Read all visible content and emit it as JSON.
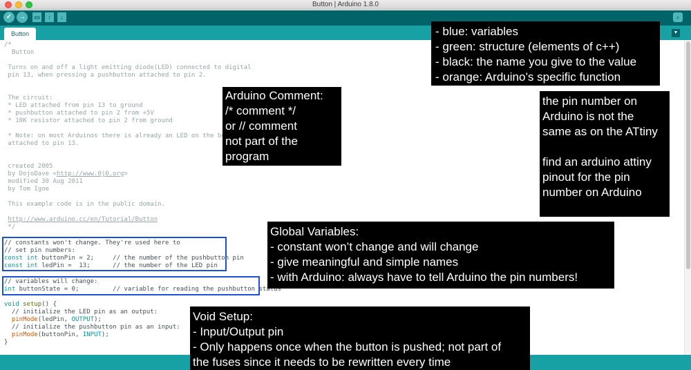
{
  "window": {
    "title": "Button | Arduino 1.8.0"
  },
  "toolbar": {
    "verify_icon": "checkmark-icon",
    "upload_icon": "arrow-right-icon",
    "new_icon": "new-file-icon",
    "open_icon": "arrow-up-icon",
    "save_icon": "arrow-down-icon",
    "serial_icon": "magnifier-icon"
  },
  "tabs": [
    {
      "label": "Button"
    }
  ],
  "code": [
    "/*",
    "  Button",
    "",
    " Turns on and off a light emitting diode(LED) connected to digital",
    " pin 13, when pressing a pushbutton attached to pin 2.",
    "",
    "",
    " The circuit:",
    " * LED attached from pin 13 to ground",
    " * pushbutton attached to pin 2 from +5V",
    " * 10K resistor attached to pin 2 from ground",
    "",
    " * Note: on most Arduinos there is already an LED on the board",
    " attached to pin 13.",
    "",
    "",
    " created 2005",
    " by DojoDave <",
    " modified 30 Aug 2011",
    " by Tom Igoe",
    "",
    " This example code is in the public domain.",
    "",
    " ",
    " */"
  ],
  "code_link_1": "http://www.0j0.org",
  "code_link_1_after": ">",
  "code_link_2": "http://www.arduino.cc/en/Tutorial/Button",
  "globals": {
    "comment1": "// constants won't change. They're used here to",
    "comment2": "// set pin numbers:",
    "kw_const": "const",
    "kw_int": "int",
    "line3_rest": " buttonPin = 2;     // the number of the pushbutton pin",
    "line4_rest": " ledPin =  13;      // the number of the LED pin",
    "comment5": "// variables will change:",
    "line6_rest": " buttonState = 0;         // variable for reading the pushbutton status"
  },
  "setup": {
    "kw_void": "void",
    "fn_setup": "setup",
    "sig_rest": "() {",
    "c1": "  // initialize the LED pin as an output:",
    "fn_pinMode": "pinMode",
    "l2_args_a": "(ledPin, ",
    "l2_const": "OUTPUT",
    "l2_end": ");",
    "c3": "  // initialize the pushbutton pin as an input:",
    "l4_args_a": "(buttonPin, ",
    "l4_const": "INPUT",
    "l4_end": ");",
    "close": "}"
  },
  "annotations": {
    "legend": [
      "- blue: variables",
      "- green: structure (elements of c++)",
      "- black: the name you give to the value",
      "- orange: Arduino’s specific function"
    ],
    "comment_note": [
      "Arduino Comment:",
      "/* comment */",
      "or // comment",
      "not part of the",
      "program"
    ],
    "pin_note_a": [
      "the pin number on",
      "Arduino is not the",
      "same as on the ATtiny"
    ],
    "pin_note_b": [
      "find an arduino attiny",
      "pinout for the pin",
      "number on Arduino"
    ],
    "global_note": [
      "Global Variables:",
      "- constant won’t change and will change",
      "- give meaningful and simple names",
      "- with Arduino: always have to tell Arduino the pin numbers!"
    ],
    "setup_note": [
      "Void Setup:",
      "- Input/Output pin",
      "- Only happens once when the button is pushed; not part of",
      "the fuses since it needs to be rewritten every time"
    ]
  }
}
